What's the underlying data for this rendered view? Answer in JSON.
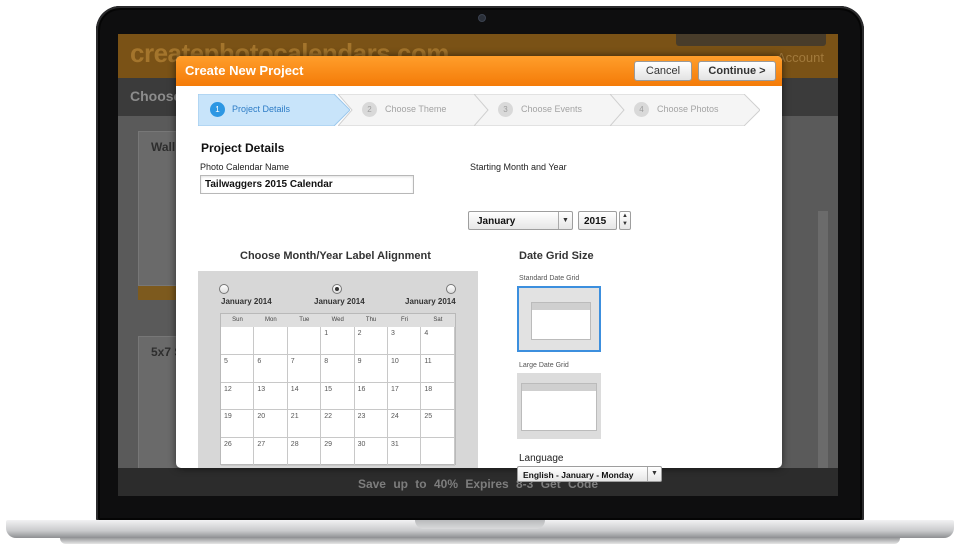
{
  "site": {
    "logo": "createphotocalendars.com",
    "account": "Account",
    "subbar_title": "Choose",
    "card1_title": "Wall",
    "card2_title": "5x7 S",
    "footer_promo": "Save up to 40%   Expires 8-3   Get Code"
  },
  "modal": {
    "title": "Create New Project",
    "cancel_label": "Cancel",
    "continue_label": "Continue >",
    "steps": [
      {
        "number": "1",
        "label": "Project Details",
        "active": true
      },
      {
        "number": "2",
        "label": "Choose Theme",
        "active": false
      },
      {
        "number": "3",
        "label": "Choose Events",
        "active": false
      },
      {
        "number": "4",
        "label": "Choose Photos",
        "active": false
      }
    ],
    "section_title": "Project Details",
    "name_label": "Photo Calendar Name",
    "name_value": "Tailwaggers 2015 Calendar",
    "start_label": "Starting Month and Year",
    "month_value": "January",
    "year_value": "2015",
    "alignment_title": "Choose Month/Year Label Alignment",
    "alignment_options": [
      {
        "label": "January 2014",
        "selected": false
      },
      {
        "label": "January 2014",
        "selected": true
      },
      {
        "label": "January 2014",
        "selected": false
      }
    ],
    "weekdays": [
      "Sun",
      "Mon",
      "Tue",
      "Wed",
      "Thu",
      "Fri",
      "Sat"
    ],
    "calendar_rows": [
      [
        "",
        "",
        "",
        "1",
        "2",
        "3",
        "4"
      ],
      [
        "5",
        "6",
        "7",
        "8",
        "9",
        "10",
        "11"
      ],
      [
        "12",
        "13",
        "14",
        "15",
        "16",
        "17",
        "18"
      ],
      [
        "19",
        "20",
        "21",
        "22",
        "23",
        "24",
        "25"
      ],
      [
        "26",
        "27",
        "28",
        "29",
        "30",
        "31",
        ""
      ]
    ],
    "grid_size_title": "Date Grid Size",
    "standard_grid_label": "Standard Date Grid",
    "large_grid_label": "Large Date Grid",
    "selected_grid": "Standard Date Grid",
    "language_label": "Language",
    "language_value": "English - January - Monday"
  },
  "colors": {
    "header_orange": "#f47b08",
    "active_step": "#2d97e3",
    "selected_border": "#3c8fde"
  }
}
